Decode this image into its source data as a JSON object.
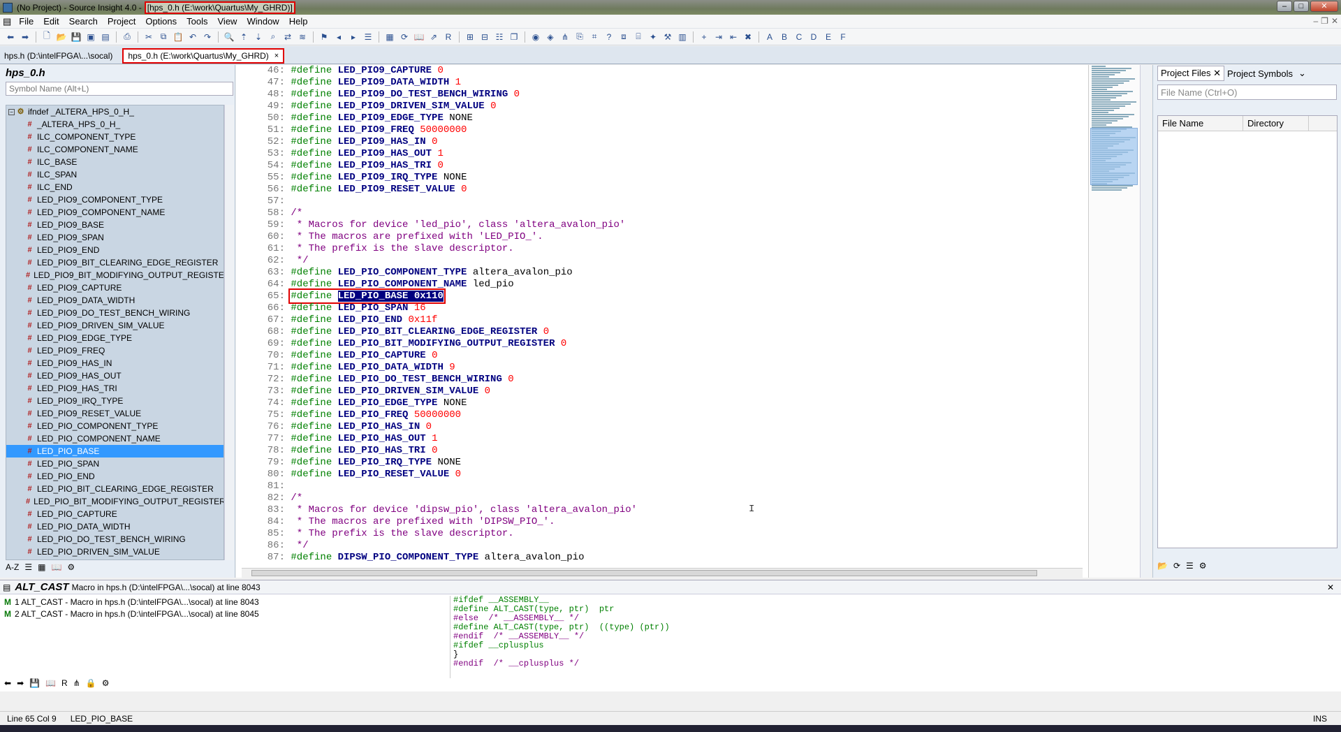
{
  "window": {
    "title_prefix": "(No Project) - Source Insight 4.0 - ",
    "title_file": "[hps_0.h (E:\\work\\Quartus\\My_GHRD)]"
  },
  "menu": [
    "File",
    "Edit",
    "Search",
    "Project",
    "Options",
    "Tools",
    "View",
    "Window",
    "Help"
  ],
  "tabs": [
    {
      "label": "hps.h (D:\\intelFPGA\\...\\socal)"
    },
    {
      "label": "hps_0.h (E:\\work\\Quartus\\My_GHRD)",
      "close": "×"
    }
  ],
  "symbol_pane": {
    "title": "hps_0.h",
    "search_placeholder": "Symbol Name (Alt+L)",
    "root": "ifndef _ALTERA_HPS_0_H_",
    "items": [
      "_ALTERA_HPS_0_H_",
      "ILC_COMPONENT_TYPE",
      "ILC_COMPONENT_NAME",
      "ILC_BASE",
      "ILC_SPAN",
      "ILC_END",
      "LED_PIO9_COMPONENT_TYPE",
      "LED_PIO9_COMPONENT_NAME",
      "LED_PIO9_BASE",
      "LED_PIO9_SPAN",
      "LED_PIO9_END",
      "LED_PIO9_BIT_CLEARING_EDGE_REGISTER",
      "LED_PIO9_BIT_MODIFYING_OUTPUT_REGISTE",
      "LED_PIO9_CAPTURE",
      "LED_PIO9_DATA_WIDTH",
      "LED_PIO9_DO_TEST_BENCH_WIRING",
      "LED_PIO9_DRIVEN_SIM_VALUE",
      "LED_PIO9_EDGE_TYPE",
      "LED_PIO9_FREQ",
      "LED_PIO9_HAS_IN",
      "LED_PIO9_HAS_OUT",
      "LED_PIO9_HAS_TRI",
      "LED_PIO9_IRQ_TYPE",
      "LED_PIO9_RESET_VALUE",
      "LED_PIO_COMPONENT_TYPE",
      "LED_PIO_COMPONENT_NAME",
      "LED_PIO_BASE",
      "LED_PIO_SPAN",
      "LED_PIO_END",
      "LED_PIO_BIT_CLEARING_EDGE_REGISTER",
      "LED_PIO_BIT_MODIFYING_OUTPUT_REGISTER",
      "LED_PIO_CAPTURE",
      "LED_PIO_DATA_WIDTH",
      "LED_PIO_DO_TEST_BENCH_WIRING",
      "LED_PIO_DRIVEN_SIM_VALUE"
    ],
    "selected_index": 26,
    "bottom_sort": "A-Z"
  },
  "code_lines": [
    {
      "n": "46:",
      "kind": "def",
      "name": "LED_PIO9_CAPTURE",
      "val": "0",
      "vt": "num"
    },
    {
      "n": "47:",
      "kind": "def",
      "name": "LED_PIO9_DATA_WIDTH",
      "val": "1",
      "vt": "num"
    },
    {
      "n": "48:",
      "kind": "def",
      "name": "LED_PIO9_DO_TEST_BENCH_WIRING",
      "val": "0",
      "vt": "num"
    },
    {
      "n": "49:",
      "kind": "def",
      "name": "LED_PIO9_DRIVEN_SIM_VALUE",
      "val": "0",
      "vt": "num"
    },
    {
      "n": "50:",
      "kind": "def",
      "name": "LED_PIO9_EDGE_TYPE",
      "val": "NONE",
      "vt": "txt"
    },
    {
      "n": "51:",
      "kind": "def",
      "name": "LED_PIO9_FREQ",
      "val": "50000000",
      "vt": "num"
    },
    {
      "n": "52:",
      "kind": "def",
      "name": "LED_PIO9_HAS_IN",
      "val": "0",
      "vt": "num"
    },
    {
      "n": "53:",
      "kind": "def",
      "name": "LED_PIO9_HAS_OUT",
      "val": "1",
      "vt": "num"
    },
    {
      "n": "54:",
      "kind": "def",
      "name": "LED_PIO9_HAS_TRI",
      "val": "0",
      "vt": "num"
    },
    {
      "n": "55:",
      "kind": "def",
      "name": "LED_PIO9_IRQ_TYPE",
      "val": "NONE",
      "vt": "txt"
    },
    {
      "n": "56:",
      "kind": "def",
      "name": "LED_PIO9_RESET_VALUE",
      "val": "0",
      "vt": "num"
    },
    {
      "n": "57:",
      "kind": "blank"
    },
    {
      "n": "58:",
      "kind": "cm",
      "text": "/*"
    },
    {
      "n": "59:",
      "kind": "cm",
      "text": " * Macros for device 'led_pio', class 'altera_avalon_pio'"
    },
    {
      "n": "60:",
      "kind": "cm",
      "text": " * The macros are prefixed with 'LED_PIO_'."
    },
    {
      "n": "61:",
      "kind": "cm",
      "text": " * The prefix is the slave descriptor."
    },
    {
      "n": "62:",
      "kind": "cm",
      "text": " */"
    },
    {
      "n": "63:",
      "kind": "def",
      "name": "LED_PIO_COMPONENT_TYPE",
      "val": "altera_avalon_pio",
      "vt": "txt"
    },
    {
      "n": "64:",
      "kind": "def",
      "name": "LED_PIO_COMPONENT_NAME",
      "val": "led_pio",
      "vt": "txt"
    },
    {
      "n": "65:",
      "kind": "def",
      "name": "LED_PIO_BASE",
      "val": "0x110",
      "vt": "sel",
      "highlight": true
    },
    {
      "n": "66:",
      "kind": "def",
      "name": "LED_PIO_SPAN",
      "val": "16",
      "vt": "num"
    },
    {
      "n": "67:",
      "kind": "def",
      "name": "LED_PIO_END",
      "val": "0x11f",
      "vt": "num"
    },
    {
      "n": "68:",
      "kind": "def",
      "name": "LED_PIO_BIT_CLEARING_EDGE_REGISTER",
      "val": "0",
      "vt": "num"
    },
    {
      "n": "69:",
      "kind": "def",
      "name": "LED_PIO_BIT_MODIFYING_OUTPUT_REGISTER",
      "val": "0",
      "vt": "num"
    },
    {
      "n": "70:",
      "kind": "def",
      "name": "LED_PIO_CAPTURE",
      "val": "0",
      "vt": "num"
    },
    {
      "n": "71:",
      "kind": "def",
      "name": "LED_PIO_DATA_WIDTH",
      "val": "9",
      "vt": "num"
    },
    {
      "n": "72:",
      "kind": "def",
      "name": "LED_PIO_DO_TEST_BENCH_WIRING",
      "val": "0",
      "vt": "num"
    },
    {
      "n": "73:",
      "kind": "def",
      "name": "LED_PIO_DRIVEN_SIM_VALUE",
      "val": "0",
      "vt": "num"
    },
    {
      "n": "74:",
      "kind": "def",
      "name": "LED_PIO_EDGE_TYPE",
      "val": "NONE",
      "vt": "txt"
    },
    {
      "n": "75:",
      "kind": "def",
      "name": "LED_PIO_FREQ",
      "val": "50000000",
      "vt": "num"
    },
    {
      "n": "76:",
      "kind": "def",
      "name": "LED_PIO_HAS_IN",
      "val": "0",
      "vt": "num"
    },
    {
      "n": "77:",
      "kind": "def",
      "name": "LED_PIO_HAS_OUT",
      "val": "1",
      "vt": "num"
    },
    {
      "n": "78:",
      "kind": "def",
      "name": "LED_PIO_HAS_TRI",
      "val": "0",
      "vt": "num"
    },
    {
      "n": "79:",
      "kind": "def",
      "name": "LED_PIO_IRQ_TYPE",
      "val": "NONE",
      "vt": "txt"
    },
    {
      "n": "80:",
      "kind": "def",
      "name": "LED_PIO_RESET_VALUE",
      "val": "0",
      "vt": "num"
    },
    {
      "n": "81:",
      "kind": "blank"
    },
    {
      "n": "82:",
      "kind": "cm",
      "text": "/*"
    },
    {
      "n": "83:",
      "kind": "cm",
      "text": " * Macros for device 'dipsw_pio', class 'altera_avalon_pio'"
    },
    {
      "n": "84:",
      "kind": "cm",
      "text": " * The macros are prefixed with 'DIPSW_PIO_'."
    },
    {
      "n": "85:",
      "kind": "cm",
      "text": " * The prefix is the slave descriptor."
    },
    {
      "n": "86:",
      "kind": "cm",
      "text": " */"
    },
    {
      "n": "87:",
      "kind": "def",
      "name": "DIPSW_PIO_COMPONENT_TYPE",
      "val": "altera_avalon_pio",
      "vt": "txt"
    }
  ],
  "define_kw": "#define",
  "project_pane": {
    "tab_files": "Project Files",
    "tab_symbols": "Project Symbols",
    "file_placeholder": "File Name (Ctrl+O)",
    "col_file": "File Name",
    "col_dir": "Directory"
  },
  "context": {
    "symbol": "ALT_CAST",
    "desc": "Macro in hps.h (D:\\intelFPGA\\...\\socal) at line 8043",
    "refs": [
      "1 ALT_CAST - Macro in hps.h (D:\\intelFPGA\\...\\socal) at line 8043",
      "2 ALT_CAST - Macro in hps.h (D:\\intelFPGA\\...\\socal) at line 8045"
    ],
    "code": [
      "#ifdef __ASSEMBLY__",
      "#define ALT_CAST(type, ptr)  ptr",
      "#else  /* __ASSEMBLY__ */",
      "#define ALT_CAST(type, ptr)  ((type) (ptr))",
      "#endif  /* __ASSEMBLY__ */",
      "#ifdef __cplusplus",
      "}",
      "#endif  /* __cplusplus */"
    ]
  },
  "status": {
    "pos": "Line 65  Col 9",
    "symbol": "LED_PIO_BASE",
    "mode": "INS"
  }
}
